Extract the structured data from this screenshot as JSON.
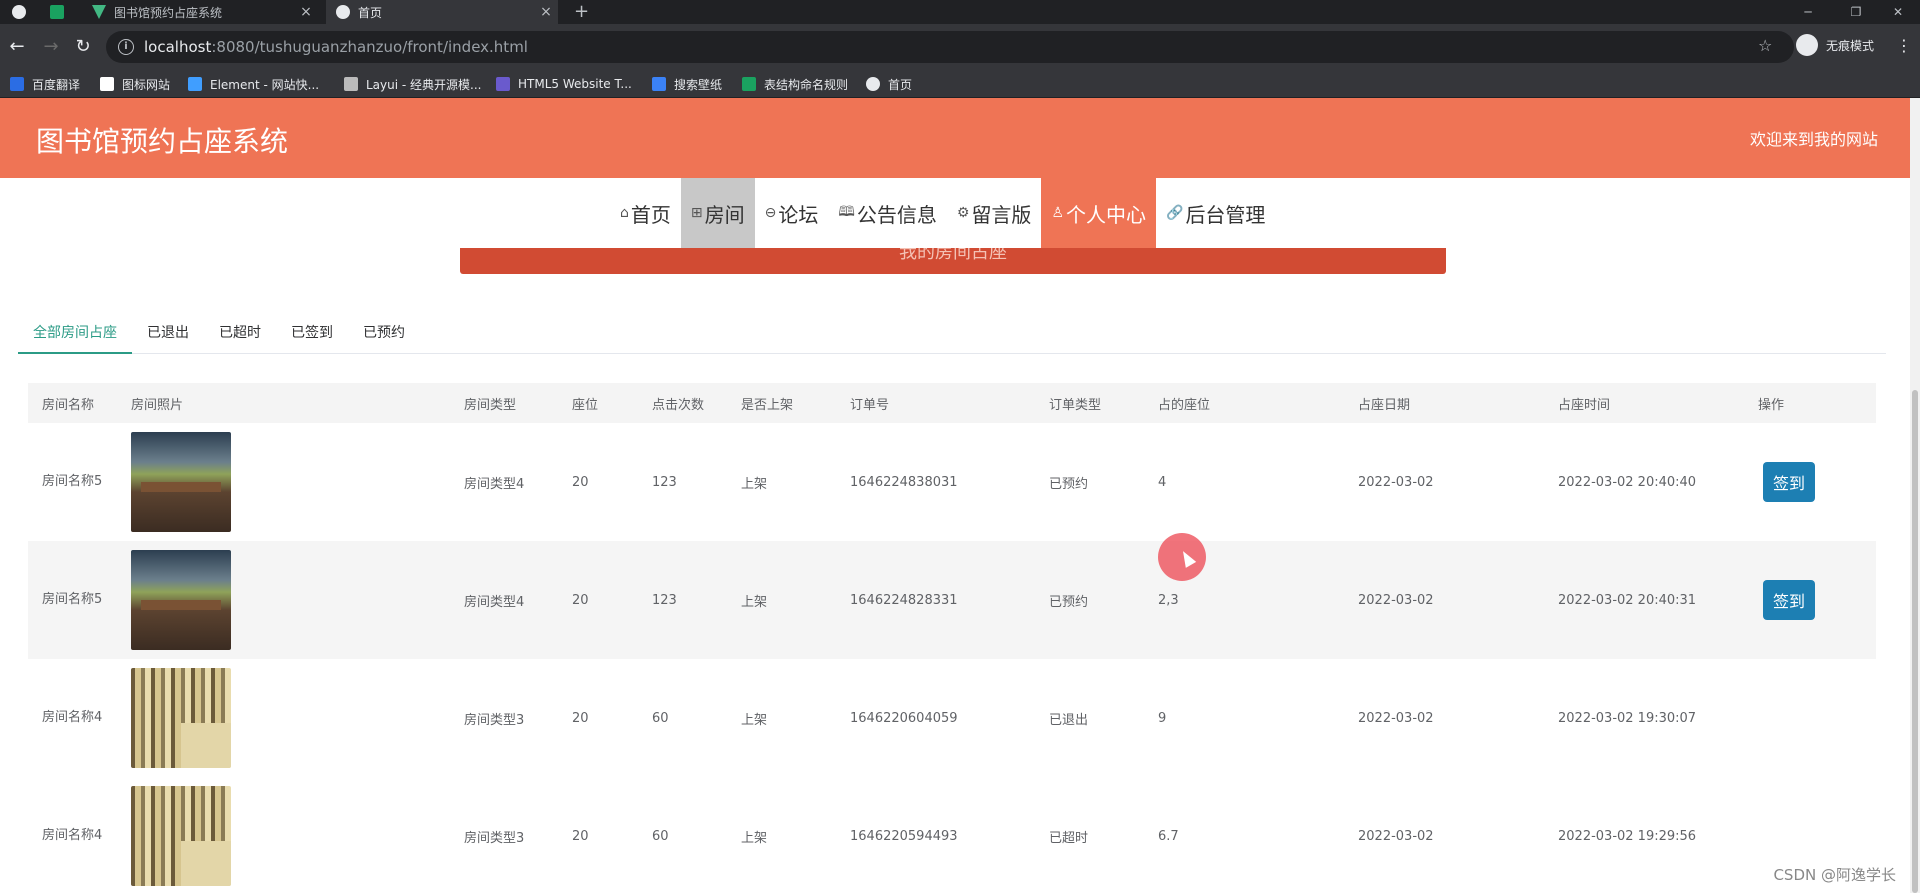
{
  "browser": {
    "tabs": [
      {
        "title": "图书馆预约占座系统"
      },
      {
        "title": "首页"
      }
    ],
    "url_host": "localhost",
    "url_rest": ":8080/tushuguanzhanzuo/front/index.html",
    "profile_label": "无痕模式",
    "bookmarks": [
      "百度翻译",
      "图标网站",
      "Element - 网站快...",
      "Layui - 经典开源模...",
      "HTML5 Website T...",
      "搜索壁纸",
      "表结构命名规则",
      "首页"
    ]
  },
  "header": {
    "site_title": "图书馆预约占座系统",
    "welcome": "欢迎来到我的网站"
  },
  "nav": [
    {
      "icon": "home-icon",
      "glyph": "⌂",
      "label": "首页"
    },
    {
      "icon": "room-icon",
      "glyph": "⊞",
      "label": "房间"
    },
    {
      "icon": "forum-icon",
      "glyph": "⊖",
      "label": "论坛"
    },
    {
      "icon": "book-icon",
      "glyph": "🕮",
      "label": "公告信息"
    },
    {
      "icon": "gear-icon",
      "glyph": "⚙",
      "label": "留言版"
    },
    {
      "icon": "user-icon",
      "glyph": "♙",
      "label": "个人中心"
    },
    {
      "icon": "link-icon",
      "glyph": "🔗",
      "label": "后台管理"
    }
  ],
  "banner": {
    "title": "我的房间占座"
  },
  "filter_tabs": [
    "全部房间占座",
    "已退出",
    "已超时",
    "已签到",
    "已预约"
  ],
  "table": {
    "headers": [
      "房间名称",
      "房间照片",
      "房间类型",
      "座位",
      "点击次数",
      "是否上架",
      "订单号",
      "订单类型",
      "占的座位",
      "占座日期",
      "占座时间",
      "操作"
    ],
    "rows": [
      {
        "name": "房间名称5",
        "photo": "modern-library",
        "type": "房间类型4",
        "seats": "20",
        "clicks": "123",
        "listed": "上架",
        "order_no": "1646224838031",
        "order_type": "已预约",
        "seat": "4",
        "date": "2022-03-02",
        "time": "2022-03-02 20:40:40",
        "action": "签到"
      },
      {
        "name": "房间名称5",
        "photo": "modern-library",
        "type": "房间类型4",
        "seats": "20",
        "clicks": "123",
        "listed": "上架",
        "order_no": "1646224828331",
        "order_type": "已预约",
        "seat": "2,3",
        "date": "2022-03-02",
        "time": "2022-03-02 20:40:31",
        "action": "签到"
      },
      {
        "name": "房间名称4",
        "photo": "bookshelf",
        "type": "房间类型3",
        "seats": "20",
        "clicks": "60",
        "listed": "上架",
        "order_no": "1646220604059",
        "order_type": "已退出",
        "seat": "9",
        "date": "2022-03-02",
        "time": "2022-03-02 19:30:07",
        "action": ""
      },
      {
        "name": "房间名称4",
        "photo": "bookshelf",
        "type": "房间类型3",
        "seats": "20",
        "clicks": "60",
        "listed": "上架",
        "order_no": "1646220594493",
        "order_type": "已超时",
        "seat": "6.7",
        "date": "2022-03-02",
        "time": "2022-03-02 19:29:56",
        "action": ""
      }
    ]
  },
  "watermark": "CSDN @阿逸学长",
  "colors": {
    "header": "#ef7455",
    "accent_tab": "#2b9b86",
    "button": "#1d7fb3"
  }
}
